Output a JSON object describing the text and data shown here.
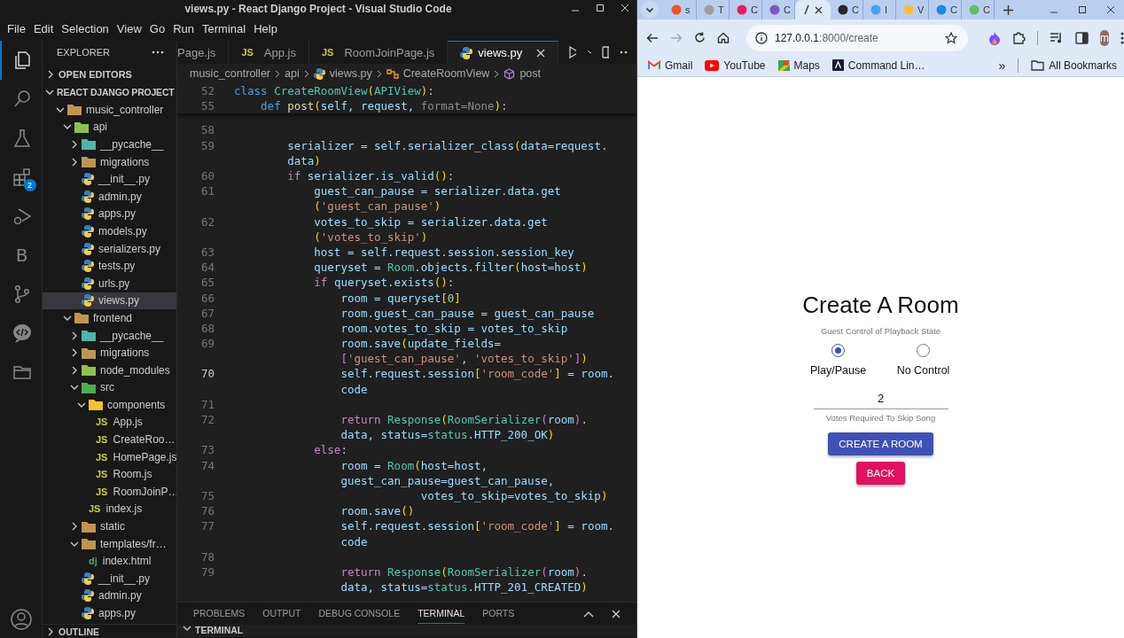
{
  "vscode": {
    "title": "views.py - React Django Project - Visual Studio Code",
    "menu": [
      "File",
      "Edit",
      "Selection",
      "View",
      "Go",
      "Run",
      "Terminal",
      "Help"
    ],
    "activity_bar": [
      {
        "kind": "files",
        "selected": true
      },
      {
        "kind": "search",
        "selected": false
      },
      {
        "kind": "testing",
        "selected": false
      },
      {
        "kind": "extensions",
        "selected": false,
        "badge": "2"
      },
      {
        "kind": "run",
        "selected": false
      },
      {
        "kind": "letter",
        "selected": false,
        "label": "B"
      },
      {
        "kind": "source-control",
        "selected": false
      },
      {
        "kind": "chat",
        "selected": false
      },
      {
        "kind": "folder",
        "selected": false
      }
    ],
    "explorer": {
      "title": "EXPLORER",
      "open_editors": {
        "label": "OPEN EDITORS",
        "expanded": false
      },
      "project": {
        "label": "REACT DJANGO PROJECT",
        "expanded": true
      },
      "tree": [
        {
          "label": "music_controller",
          "kind": "folder",
          "color": "#c09553",
          "expanded": true,
          "selected": false,
          "children": [
            {
              "label": "api",
              "kind": "folder",
              "color": "#8bc34a",
              "expanded": true,
              "selected": false,
              "children": [
                {
                  "label": "__pycache__",
                  "kind": "folder",
                  "color": "#4db6ac",
                  "expanded": false,
                  "selected": false
                },
                {
                  "label": "migrations",
                  "kind": "folder",
                  "color": "#c09553",
                  "expanded": false,
                  "selected": false
                },
                {
                  "label": "__init__.py",
                  "kind": "py",
                  "selected": false
                },
                {
                  "label": "admin.py",
                  "kind": "py",
                  "selected": false
                },
                {
                  "label": "apps.py",
                  "kind": "py",
                  "selected": false
                },
                {
                  "label": "models.py",
                  "kind": "py",
                  "selected": false
                },
                {
                  "label": "serializers.py",
                  "kind": "py",
                  "selected": false
                },
                {
                  "label": "tests.py",
                  "kind": "py",
                  "selected": false
                },
                {
                  "label": "urls.py",
                  "kind": "py",
                  "selected": false
                },
                {
                  "label": "views.py",
                  "kind": "py",
                  "selected": true
                }
              ]
            },
            {
              "label": "frontend",
              "kind": "folder",
              "color": "#c09553",
              "expanded": true,
              "selected": false,
              "children": [
                {
                  "label": "__pycache__",
                  "kind": "folder",
                  "color": "#4db6ac",
                  "expanded": false,
                  "selected": false
                },
                {
                  "label": "migrations",
                  "kind": "folder",
                  "color": "#c09553",
                  "expanded": false,
                  "selected": false
                },
                {
                  "label": "node_modules",
                  "kind": "folder",
                  "color": "#8bc34a",
                  "expanded": false,
                  "selected": false
                },
                {
                  "label": "src",
                  "kind": "folder",
                  "color": "#4caf50",
                  "expanded": true,
                  "selected": false,
                  "children": [
                    {
                      "label": "components",
                      "kind": "folder",
                      "color": "#fbc02d",
                      "expanded": true,
                      "selected": false,
                      "children": [
                        {
                          "label": "App.js",
                          "kind": "js",
                          "icon_text": "JS",
                          "selected": false
                        },
                        {
                          "label": "CreateRoo…",
                          "kind": "js",
                          "icon_text": "JS",
                          "selected": false
                        },
                        {
                          "label": "HomePage.js",
                          "kind": "js",
                          "icon_text": "JS",
                          "selected": false
                        },
                        {
                          "label": "Room.js",
                          "kind": "js",
                          "icon_text": "JS",
                          "selected": false
                        },
                        {
                          "label": "RoomJoinP…",
                          "kind": "js",
                          "icon_text": "JS",
                          "selected": false
                        }
                      ]
                    },
                    {
                      "label": "index.js",
                      "kind": "js",
                      "icon_text": "JS",
                      "selected": false
                    }
                  ]
                },
                {
                  "label": "static",
                  "kind": "folder",
                  "color": "#c09553",
                  "expanded": false,
                  "selected": false
                },
                {
                  "label": "templates/fr…",
                  "kind": "folder",
                  "color": "#c09553",
                  "expanded": true,
                  "selected": false,
                  "children": [
                    {
                      "label": "index.html",
                      "kind": "html",
                      "icon_text": "dj",
                      "selected": false
                    }
                  ]
                },
                {
                  "label": "__init__.py",
                  "kind": "py",
                  "selected": false
                },
                {
                  "label": "admin.py",
                  "kind": "py",
                  "selected": false
                },
                {
                  "label": "apps.py",
                  "kind": "py",
                  "selected": false
                }
              ]
            }
          ]
        }
      ],
      "outline": {
        "label": "OUTLINE",
        "expanded": false
      }
    },
    "tabs": [
      {
        "label": "Page.js",
        "kind": "cut",
        "selected": false
      },
      {
        "label": "App.js",
        "kind": "js",
        "icon_text": "JS",
        "selected": false
      },
      {
        "label": "RoomJoinPage.js",
        "kind": "js",
        "icon_text": "JS",
        "selected": false
      },
      {
        "label": "views.py",
        "kind": "py",
        "selected": true
      }
    ],
    "breadcrumbs": [
      {
        "label": "music_controller",
        "kind": "folder"
      },
      {
        "label": "api",
        "kind": "folder"
      },
      {
        "label": "views.py",
        "kind": "py"
      },
      {
        "label": "CreateRoomView",
        "kind": "class"
      },
      {
        "label": "post",
        "kind": "method"
      }
    ],
    "sticky": [
      {
        "number": "52",
        "current": false,
        "segments": [
          {
            "text": "class ",
            "kind": "k"
          },
          {
            "text": "CreateRoomView",
            "kind": "t"
          },
          {
            "text": "(",
            "kind": "b"
          },
          {
            "text": "APIView",
            "kind": "t"
          },
          {
            "text": ")",
            "kind": "b"
          },
          {
            "text": ":",
            "kind": "p"
          }
        ]
      },
      {
        "number": "55",
        "current": false,
        "segments": [
          {
            "text": "    def ",
            "kind": "k"
          },
          {
            "text": "post",
            "kind": "f"
          },
          {
            "text": "(",
            "kind": "b"
          },
          {
            "text": "self, request, ",
            "kind": "v"
          },
          {
            "text": "format=None",
            "kind": "d"
          },
          {
            "text": ")",
            "kind": "b"
          },
          {
            "text": ":",
            "kind": "p"
          }
        ]
      }
    ],
    "lines": [
      {
        "number": "58",
        "current": false
      },
      {
        "number": "59",
        "current": false,
        "segments": [
          {
            "text": "        serializer = self.serializer_class",
            "kind": "v"
          },
          {
            "text": "(",
            "kind": "b"
          },
          {
            "text": "data=request.",
            "kind": "v"
          }
        ]
      },
      {
        "segments": [
          {
            "text": "        data",
            "kind": "v"
          },
          {
            "text": ")",
            "kind": "b"
          }
        ]
      },
      {
        "number": "60",
        "current": false,
        "segments": [
          {
            "text": "        if ",
            "kind": "c"
          },
          {
            "text": "serializer.is_valid",
            "kind": "v"
          },
          {
            "text": "()",
            "kind": "b"
          },
          {
            "text": ":",
            "kind": "p"
          }
        ]
      },
      {
        "number": "61",
        "current": false,
        "segments": [
          {
            "text": "            guest_can_pause = serializer.data.get",
            "kind": "v"
          }
        ]
      },
      {
        "segments": [
          {
            "text": "            (",
            "kind": "b"
          },
          {
            "text": "'guest_can_pause'",
            "kind": "s"
          },
          {
            "text": ")",
            "kind": "b"
          }
        ]
      },
      {
        "number": "62",
        "current": false,
        "segments": [
          {
            "text": "            votes_to_skip = serializer.data.get",
            "kind": "v"
          }
        ]
      },
      {
        "segments": [
          {
            "text": "            (",
            "kind": "b"
          },
          {
            "text": "'votes_to_skip'",
            "kind": "s"
          },
          {
            "text": ")",
            "kind": "b"
          }
        ]
      },
      {
        "number": "63",
        "current": false,
        "segments": [
          {
            "text": "            host = self.request.session.session_key",
            "kind": "v"
          }
        ]
      },
      {
        "number": "64",
        "current": false,
        "segments": [
          {
            "text": "            queryset = ",
            "kind": "v"
          },
          {
            "text": "Room",
            "kind": "t"
          },
          {
            "text": ".objects.filter",
            "kind": "v"
          },
          {
            "text": "(",
            "kind": "b"
          },
          {
            "text": "host=host",
            "kind": "v"
          },
          {
            "text": ")",
            "kind": "b"
          }
        ]
      },
      {
        "number": "65",
        "current": false,
        "segments": [
          {
            "text": "            if ",
            "kind": "c"
          },
          {
            "text": "queryset.exists",
            "kind": "v"
          },
          {
            "text": "()",
            "kind": "b"
          },
          {
            "text": ":",
            "kind": "p"
          }
        ]
      },
      {
        "number": "66",
        "current": false,
        "segments": [
          {
            "text": "                room = queryset",
            "kind": "v"
          },
          {
            "text": "[",
            "kind": "b"
          },
          {
            "text": "0",
            "kind": "n"
          },
          {
            "text": "]",
            "kind": "b"
          }
        ]
      },
      {
        "number": "67",
        "current": false,
        "segments": [
          {
            "text": "                room.guest_can_pause = guest_can_pause",
            "kind": "v"
          }
        ]
      },
      {
        "number": "68",
        "current": false,
        "segments": [
          {
            "text": "                room.votes_to_skip = votes_to_skip",
            "kind": "v"
          }
        ]
      },
      {
        "number": "69",
        "current": false,
        "segments": [
          {
            "text": "                room.save",
            "kind": "v"
          },
          {
            "text": "(",
            "kind": "b"
          },
          {
            "text": "update_fields=",
            "kind": "v"
          }
        ]
      },
      {
        "segments": [
          {
            "text": "                [",
            "kind": "b2"
          },
          {
            "text": "'guest_can_pause'",
            "kind": "s"
          },
          {
            "text": ", ",
            "kind": "p"
          },
          {
            "text": "'votes_to_skip'",
            "kind": "s"
          },
          {
            "text": "]",
            "kind": "b2"
          },
          {
            "text": ")",
            "kind": "b"
          }
        ]
      },
      {
        "number": "70",
        "current": true,
        "segments": [
          {
            "text": "                self.request.session",
            "kind": "v"
          },
          {
            "text": "[",
            "kind": "b"
          },
          {
            "text": "'room_code'",
            "kind": "s"
          },
          {
            "text": "]",
            "kind": "b"
          },
          {
            "text": " = room.",
            "kind": "v"
          }
        ]
      },
      {
        "segments": [
          {
            "text": "                code",
            "kind": "v"
          }
        ]
      },
      {
        "number": "71",
        "current": false
      },
      {
        "number": "72",
        "current": false,
        "segments": [
          {
            "text": "                return ",
            "kind": "c"
          },
          {
            "text": "Response",
            "kind": "t"
          },
          {
            "text": "(",
            "kind": "b"
          },
          {
            "text": "RoomSerializer",
            "kind": "t"
          },
          {
            "text": "(",
            "kind": "b2"
          },
          {
            "text": "room",
            "kind": "v"
          },
          {
            "text": ")",
            "kind": "b2"
          },
          {
            "text": ".",
            "kind": "p"
          }
        ]
      },
      {
        "segments": [
          {
            "text": "                data, status=",
            "kind": "v"
          },
          {
            "text": "status",
            "kind": "t"
          },
          {
            "text": ".HTTP_200_OK",
            "kind": "v"
          },
          {
            "text": ")",
            "kind": "b"
          }
        ]
      },
      {
        "number": "73",
        "current": false,
        "segments": [
          {
            "text": "            else",
            "kind": "c"
          },
          {
            "text": ":",
            "kind": "p"
          }
        ]
      },
      {
        "number": "74",
        "current": false,
        "segments": [
          {
            "text": "                room = ",
            "kind": "v"
          },
          {
            "text": "Room",
            "kind": "t"
          },
          {
            "text": "(",
            "kind": "b"
          },
          {
            "text": "host=host,",
            "kind": "v"
          }
        ]
      },
      {
        "segments": [
          {
            "text": "                guest_can_pause=guest_can_pause,",
            "kind": "v"
          }
        ]
      },
      {
        "number": "75",
        "current": false,
        "segments": [
          {
            "text": "                            votes_to_skip=votes_to_skip",
            "kind": "v"
          },
          {
            "text": ")",
            "kind": "b"
          }
        ]
      },
      {
        "number": "76",
        "current": false,
        "segments": [
          {
            "text": "                room.save",
            "kind": "v"
          },
          {
            "text": "()",
            "kind": "b"
          }
        ]
      },
      {
        "number": "77",
        "current": false,
        "segments": [
          {
            "text": "                self.request.session",
            "kind": "v"
          },
          {
            "text": "[",
            "kind": "b"
          },
          {
            "text": "'room_code'",
            "kind": "s"
          },
          {
            "text": "]",
            "kind": "b"
          },
          {
            "text": " = room.",
            "kind": "v"
          }
        ]
      },
      {
        "segments": [
          {
            "text": "                code",
            "kind": "v"
          }
        ]
      },
      {
        "number": "78",
        "current": false
      },
      {
        "number": "79",
        "current": false,
        "segments": [
          {
            "text": "                return ",
            "kind": "c"
          },
          {
            "text": "Response",
            "kind": "t"
          },
          {
            "text": "(",
            "kind": "b"
          },
          {
            "text": "RoomSerializer",
            "kind": "t"
          },
          {
            "text": "(",
            "kind": "b2"
          },
          {
            "text": "room",
            "kind": "v"
          },
          {
            "text": ")",
            "kind": "b2"
          },
          {
            "text": ".",
            "kind": "p"
          }
        ]
      },
      {
        "segments": [
          {
            "text": "                data, status=",
            "kind": "v"
          },
          {
            "text": "status",
            "kind": "t"
          },
          {
            "text": ".HTTP_201_CREATED",
            "kind": "v"
          },
          {
            "text": ")",
            "kind": "b"
          }
        ]
      }
    ],
    "panel": {
      "tabs": [
        {
          "label": "PROBLEMS",
          "selected": false
        },
        {
          "label": "OUTPUT",
          "selected": false
        },
        {
          "label": "DEBUG CONSOLE",
          "selected": false
        },
        {
          "label": "TERMINAL",
          "selected": true
        },
        {
          "label": "PORTS",
          "selected": false
        }
      ],
      "section": "TERMINAL"
    }
  },
  "browser": {
    "tabs": [
      {
        "title": "s",
        "color": "#f4511e",
        "selected": false
      },
      {
        "title": "T",
        "color": "#9e9e9e",
        "selected": false
      },
      {
        "title": "C",
        "color": "#e91e63",
        "selected": false
      },
      {
        "title": "C",
        "color": "#7e57c2",
        "selected": false
      },
      {
        "color": "#37474f",
        "selected": true
      },
      {
        "title": "C",
        "color": "#24292f",
        "selected": false
      },
      {
        "title": "I",
        "color": "#42a5f5",
        "selected": false
      },
      {
        "title": "V",
        "color": "#fbc02d",
        "selected": false
      },
      {
        "title": "C",
        "color": "#1e88e5",
        "selected": false
      },
      {
        "title": "C",
        "color": "#66bb6a",
        "selected": false
      }
    ],
    "forward_disabled": true,
    "url_host": "127.0.0.1",
    "url_path": ":8000/create",
    "bookmarks": [
      {
        "label": "Gmail",
        "kind": "gmail"
      },
      {
        "label": "YouTube",
        "kind": "youtube"
      },
      {
        "label": "Maps",
        "kind": "maps"
      },
      {
        "label": "Command Lin…",
        "kind": "app"
      }
    ],
    "more_bookmarks": "»",
    "all_bookmarks": "All Bookmarks",
    "profile_initial": "m",
    "page": {
      "title": "Create A Room",
      "group_label": "Guest Control of Playback State",
      "options": [
        {
          "label": "Play/Pause",
          "selected": true
        },
        {
          "label": "No Control",
          "selected": false
        }
      ],
      "votes": {
        "value": "2",
        "helper": "Votes Required To Skip Song"
      },
      "buttons": [
        {
          "label": "CREATE A ROOM",
          "kind": "primary"
        },
        {
          "label": "BACK",
          "kind": "secondary"
        }
      ]
    }
  }
}
